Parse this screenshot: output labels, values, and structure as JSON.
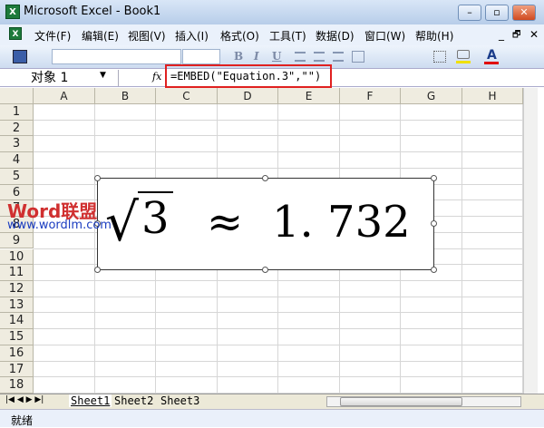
{
  "window": {
    "title": "Microsoft Excel - Book1",
    "app_icon": "X",
    "minimize": "–",
    "restore": "▫",
    "close": "✕"
  },
  "menu": {
    "items": [
      "文件(F)",
      "编辑(E)",
      "视图(V)",
      "插入(I)",
      "格式(O)",
      "工具(T)",
      "数据(D)",
      "窗口(W)",
      "帮助(H)"
    ],
    "doc_min": "_",
    "doc_restore": "🗗",
    "doc_close": "✕"
  },
  "toolbar": {
    "bold": "B",
    "italic": "I",
    "underline": "U",
    "font_color": "A",
    "fill_color_hex": "#f0e000",
    "font_color_hex": "#e00000"
  },
  "formula_bar": {
    "name_box": "对象 1",
    "fx": "fx",
    "formula": "=EMBED(\"Equation.3\",\"\")",
    "highlight_color": "#e02020"
  },
  "columns": [
    "A",
    "B",
    "C",
    "D",
    "E",
    "F",
    "G",
    "H"
  ],
  "rows": [
    "1",
    "2",
    "3",
    "4",
    "5",
    "6",
    "7",
    "8",
    "9",
    "10",
    "11",
    "12",
    "13",
    "14",
    "15",
    "16",
    "17",
    "18"
  ],
  "equation": {
    "radical": "√",
    "radicand": "3",
    "approx": "≈",
    "value": "1. 732"
  },
  "watermark": {
    "logo": "Word联盟",
    "url": "www.wordlm.com"
  },
  "sheets": [
    "Sheet1",
    "Sheet2",
    "Sheet3"
  ],
  "status": {
    "text": "就绪"
  }
}
